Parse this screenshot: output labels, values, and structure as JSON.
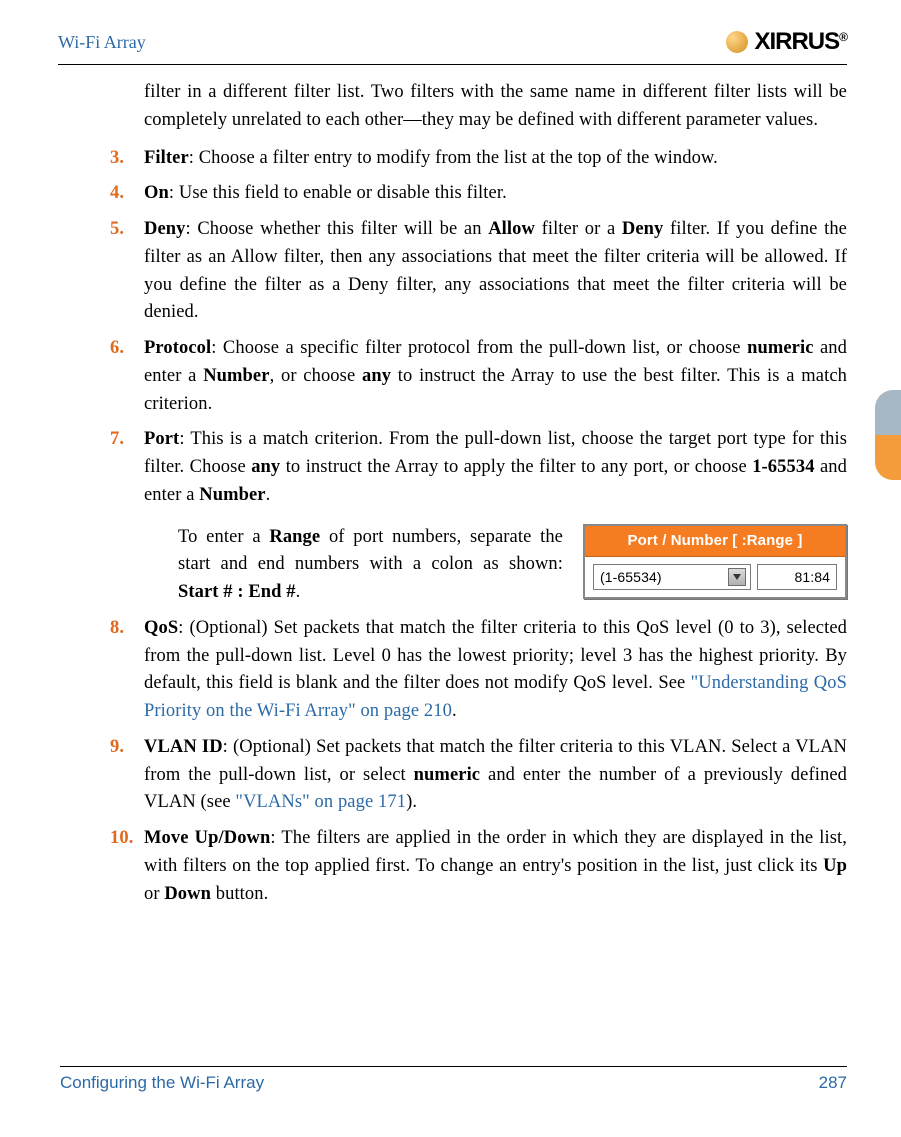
{
  "header": {
    "title": "Wi-Fi Array",
    "logo_text": "XIRRUS",
    "logo_reg": "®"
  },
  "footer": {
    "section": "Configuring the Wi-Fi Array",
    "page_number": "287"
  },
  "continuation": "filter in a different filter list. Two filters with the same name in different filter lists will be completely unrelated to each other—they may be defined with different parameter values.",
  "items": [
    {
      "num": "3.",
      "term": "Filter",
      "text": ": Choose a filter entry to modify from the list at the top of the window."
    },
    {
      "num": "4.",
      "term": "On",
      "text": ": Use this field to enable or disable this filter."
    },
    {
      "num": "5.",
      "term": "Deny",
      "text_pre": ": Choose whether this filter will be an ",
      "bold1": "Allow",
      "text_mid1": " filter or a ",
      "bold2": "Deny",
      "text_post": " filter. If you define the filter as an Allow filter, then any associations that meet the filter criteria will be allowed. If you define the filter as a Deny filter, any associations that meet the filter criteria will be denied."
    },
    {
      "num": "6.",
      "term": "Protocol",
      "text_pre": ": Choose a specific filter protocol from the pull-down list, or choose ",
      "bold1": "numeric",
      "text_mid1": " and enter a ",
      "bold2": "Number",
      "text_mid2": ", or choose ",
      "bold3": "any",
      "text_post": " to instruct the Array to use the best filter. This is a match criterion."
    },
    {
      "num": "7.",
      "term": "Port",
      "text_pre": ": This is a match criterion. From the pull-down list, choose the target port type for this filter. Choose ",
      "bold1": "any",
      "text_mid1": " to instruct the Array to apply the filter to any port, or choose ",
      "bold2": "1-65534",
      "text_mid2": " and enter a ",
      "bold3": "Number",
      "text_post": ".",
      "sub": {
        "text_pre": "To enter a ",
        "bold1": "Range",
        "text_mid1": " of port numbers, separate the start and end numbers with a colon as shown: ",
        "bold2": "Start # : End #",
        "text_post": "."
      }
    },
    {
      "num": "8.",
      "term": "QoS",
      "text_pre": ": (Optional) Set packets that match the filter criteria to this QoS level (0 to 3), selected from the pull-down list. Level 0 has the lowest priority; level 3 has the highest priority. By default, this field is blank and the filter does not modify QoS level. See ",
      "link1": "\"Understanding QoS Priority on the Wi-Fi Array\" on page 210",
      "text_post": "."
    },
    {
      "num": "9.",
      "term": "VLAN ID",
      "text_pre": ": (Optional) Set packets that match the filter criteria to this VLAN. Select a VLAN from the pull-down list, or select ",
      "bold1": "numeric",
      "text_mid1": " and enter the number of a previously defined VLAN (see ",
      "link1": "\"VLANs\" on page 171",
      "text_post": ")."
    },
    {
      "num": "10.",
      "term": "Move Up/Down",
      "text_pre": ": The filters are applied in the order in which they are displayed in the list, with filters on the top applied first. To change an entry's position in the list, just click its ",
      "bold1": "Up",
      "text_mid1": " or ",
      "bold2": "Down",
      "text_post": " button."
    }
  ],
  "port_widget": {
    "header": "Port / Number [ :Range ]",
    "select_value": "(1-65534)",
    "input_value": "81:84"
  }
}
